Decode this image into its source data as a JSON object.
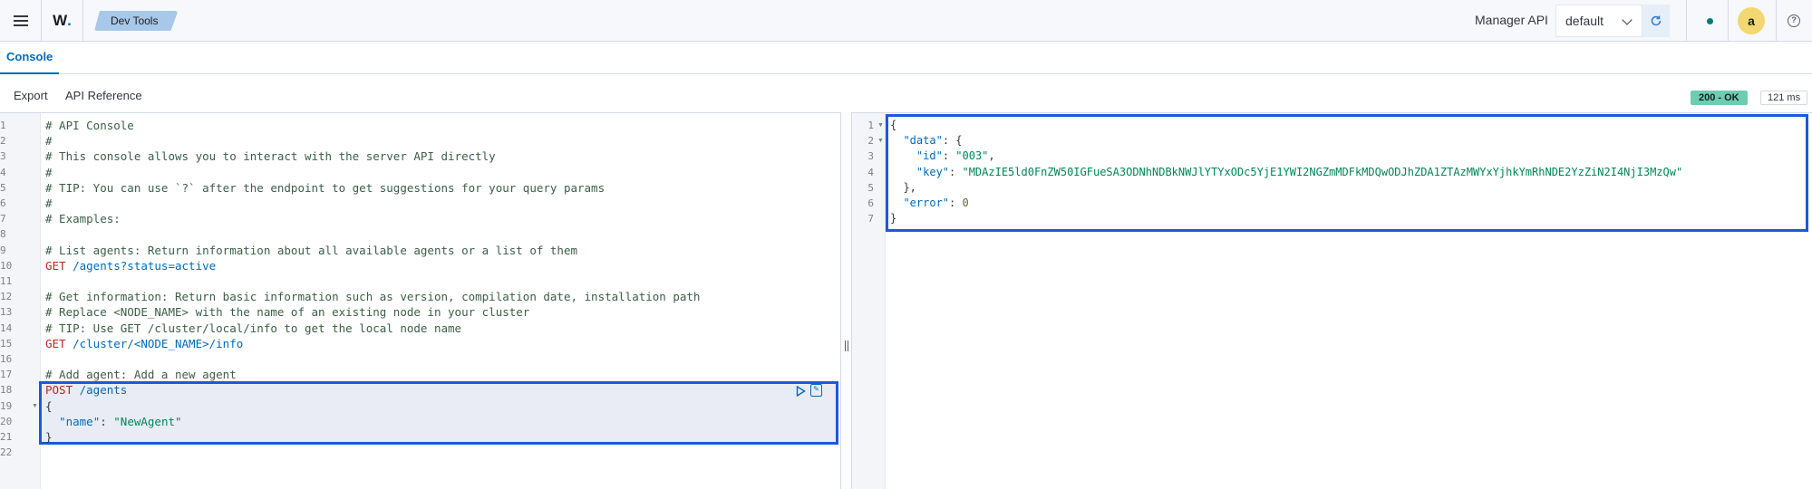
{
  "header": {
    "logo_text": "W",
    "logo_dot": ".",
    "breadcrumb": "Dev Tools",
    "manager_label": "Manager API",
    "selected_api": "default",
    "avatar_letter": "a",
    "help_glyph": "?",
    "status_color": "#017d73"
  },
  "tabs": [
    {
      "label": "Console",
      "active": true
    }
  ],
  "toolbar": {
    "export_label": "Export",
    "api_reference_label": "API Reference",
    "status_badge": "200 - OK",
    "timing_badge": "121 ms"
  },
  "request_editor": {
    "line_numbers": [
      "1",
      "2",
      "3",
      "4",
      "5",
      "6",
      "7",
      "8",
      "9",
      "10",
      "11",
      "12",
      "13",
      "14",
      "15",
      "16",
      "17",
      "18",
      "19",
      "20",
      "21",
      "22"
    ],
    "lines": [
      "# API Console",
      "#",
      "# This console allows you to interact with the server API directly",
      "#",
      "# TIP: You can use `?` after the endpoint to get suggestions for your query params",
      "#",
      "# Examples:",
      "",
      "# List agents: Return information about all available agents or a list of them",
      "GET /agents?status=active",
      "",
      "# Get information: Return basic information such as version, compilation date, installation path",
      "# Replace <NODE_NAME> with the name of an existing node in your cluster",
      "# TIP: Use GET /cluster/local/info to get the local node name",
      "GET /cluster/<NODE_NAME>/info",
      "",
      "# Add agent: Add a new agent",
      "POST /agents",
      "{",
      "  \"name\": \"NewAgent\"",
      "}",
      ""
    ],
    "tokens": {
      "get": "GET",
      "post": "POST",
      "path_agents_active": " /agents?status=active",
      "path_cluster_info": " /cluster/<NODE_NAME>/info",
      "path_agents": " /agents",
      "key_name": "\"name\"",
      "val_name": "\"NewAgent\""
    }
  },
  "response_editor": {
    "line_numbers": [
      "1",
      "2",
      "3",
      "4",
      "5",
      "6",
      "7"
    ],
    "tokens": {
      "data_key": "\"data\"",
      "id_key": "\"id\"",
      "id_val": "\"003\"",
      "key_key": "\"key\"",
      "key_val": "\"MDAzIE5ld0FnZW50IGFueSA3ODNhNDBkNWJlYTYxODc5YjE1YWI2NGZmMDFkMDQwODJhZDA1ZTAzMWYxYjhkYmRhNDE2YzZiN2I4NjI3MzQw\"",
      "error_key": "\"error\"",
      "error_val": "0"
    }
  }
}
